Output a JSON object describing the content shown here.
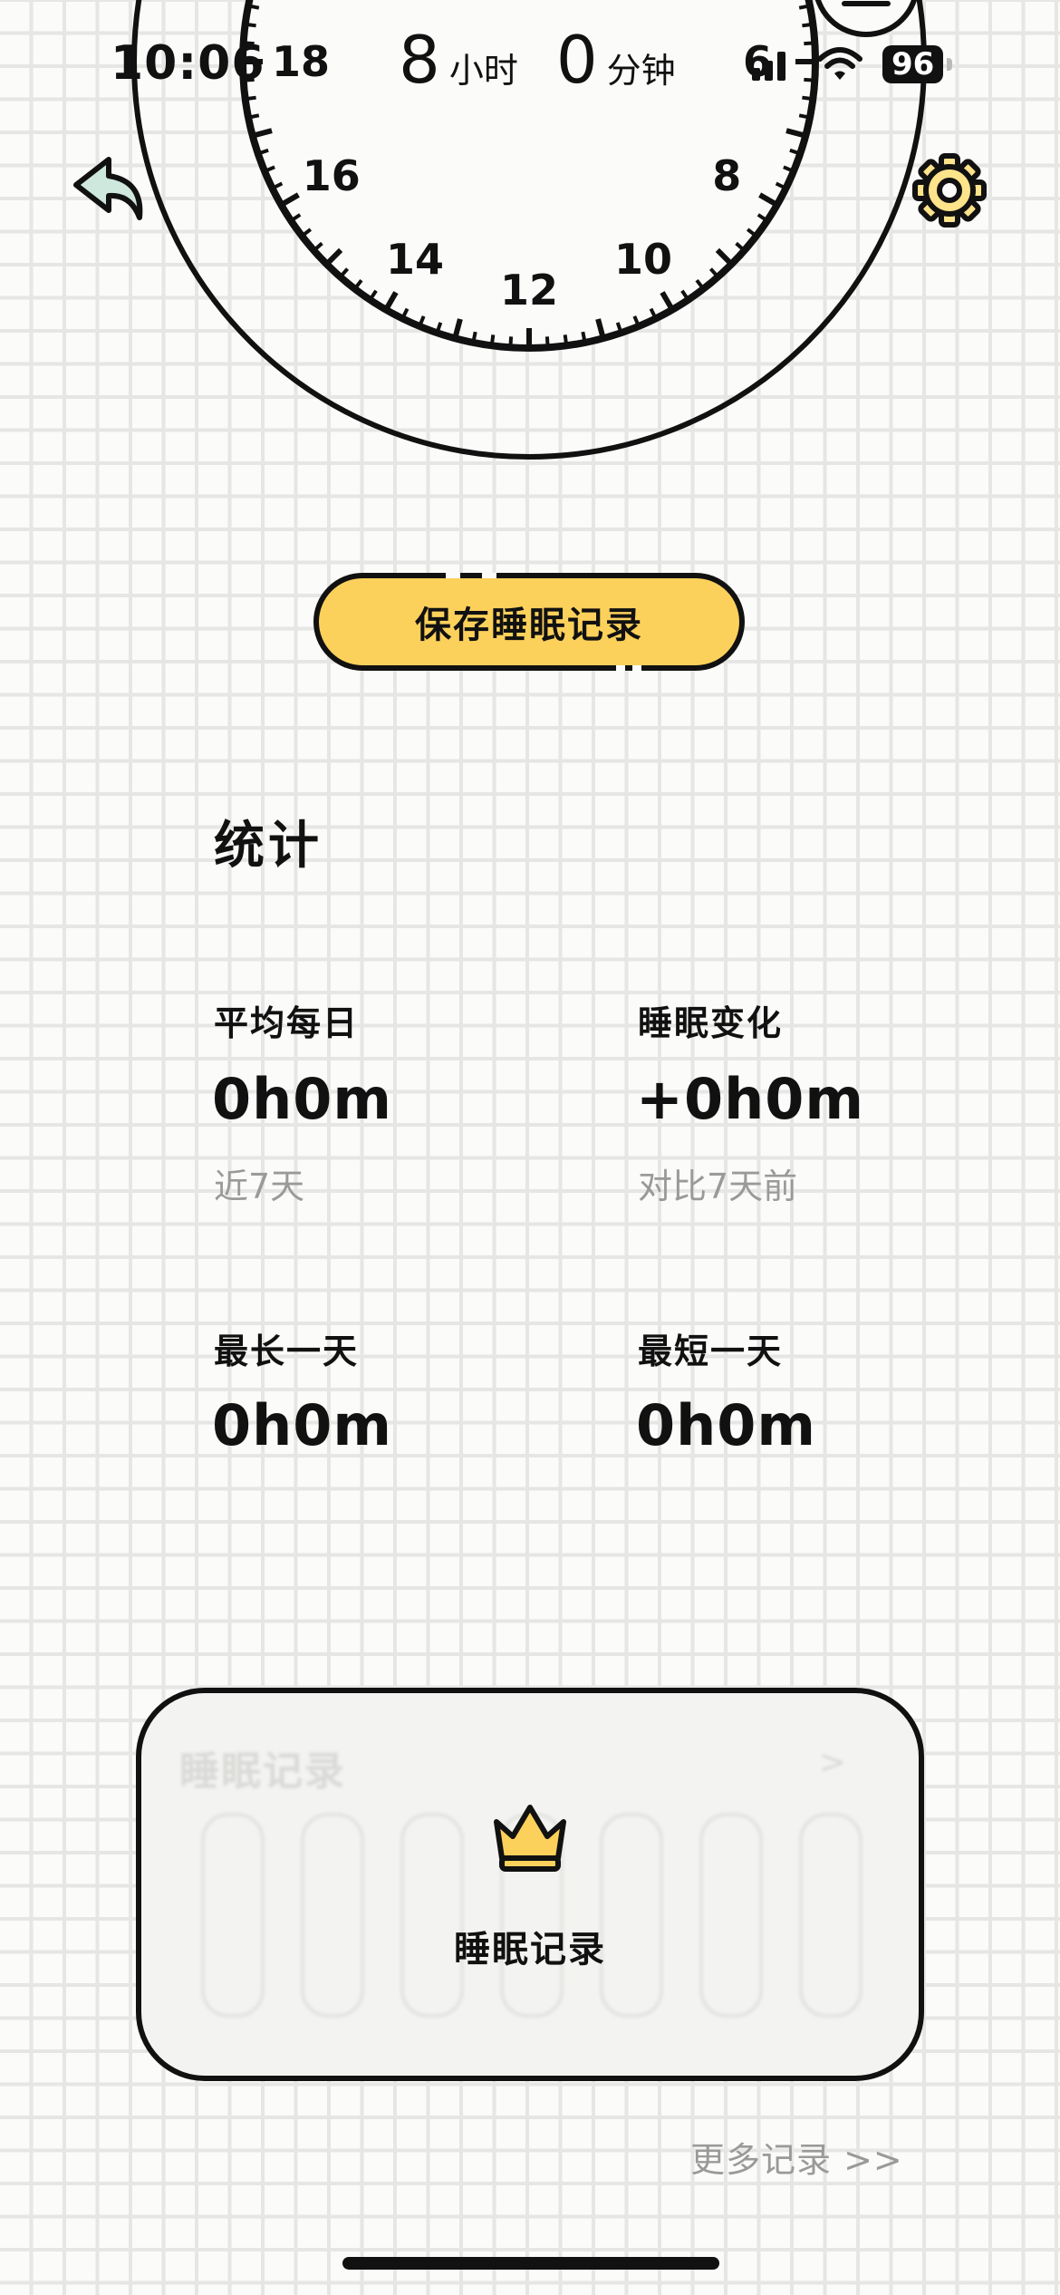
{
  "status_bar": {
    "time": "10:06",
    "battery": "96"
  },
  "sleep_duration": {
    "hours": "8",
    "hours_unit": "小时",
    "minutes": "0",
    "minutes_unit": "分钟"
  },
  "clock_dial": {
    "hour_labels": [
      "18",
      "16",
      "14",
      "12",
      "10",
      "8",
      "6"
    ]
  },
  "icons": {
    "back": "back-arrow-icon",
    "settings": "gear-icon",
    "menu": "menu-icon",
    "crown": "crown-icon"
  },
  "actions": {
    "save_label": "保存睡眠记录"
  },
  "stats": {
    "title": "统计",
    "avg_daily": {
      "label": "平均每日",
      "value": "0h0m",
      "sub": "近7天"
    },
    "change": {
      "label": "睡眠变化",
      "value": "+0h0m",
      "sub": "对比7天前"
    },
    "longest": {
      "label": "最长一天",
      "value": "0h0m"
    },
    "shortest": {
      "label": "最短一天",
      "value": "0h0m"
    }
  },
  "records_card": {
    "ghost_title": "睡眠记录",
    "ghost_arrow": ">",
    "label": "睡眠记录"
  },
  "more_link": "更多记录 >>",
  "colors": {
    "accent_yellow": "#fcd15b",
    "back_icon_fill": "#cfe8de",
    "settings_icon_fill": "#fde38a",
    "ink": "#111111",
    "muted_text": "#9a9a9a"
  }
}
